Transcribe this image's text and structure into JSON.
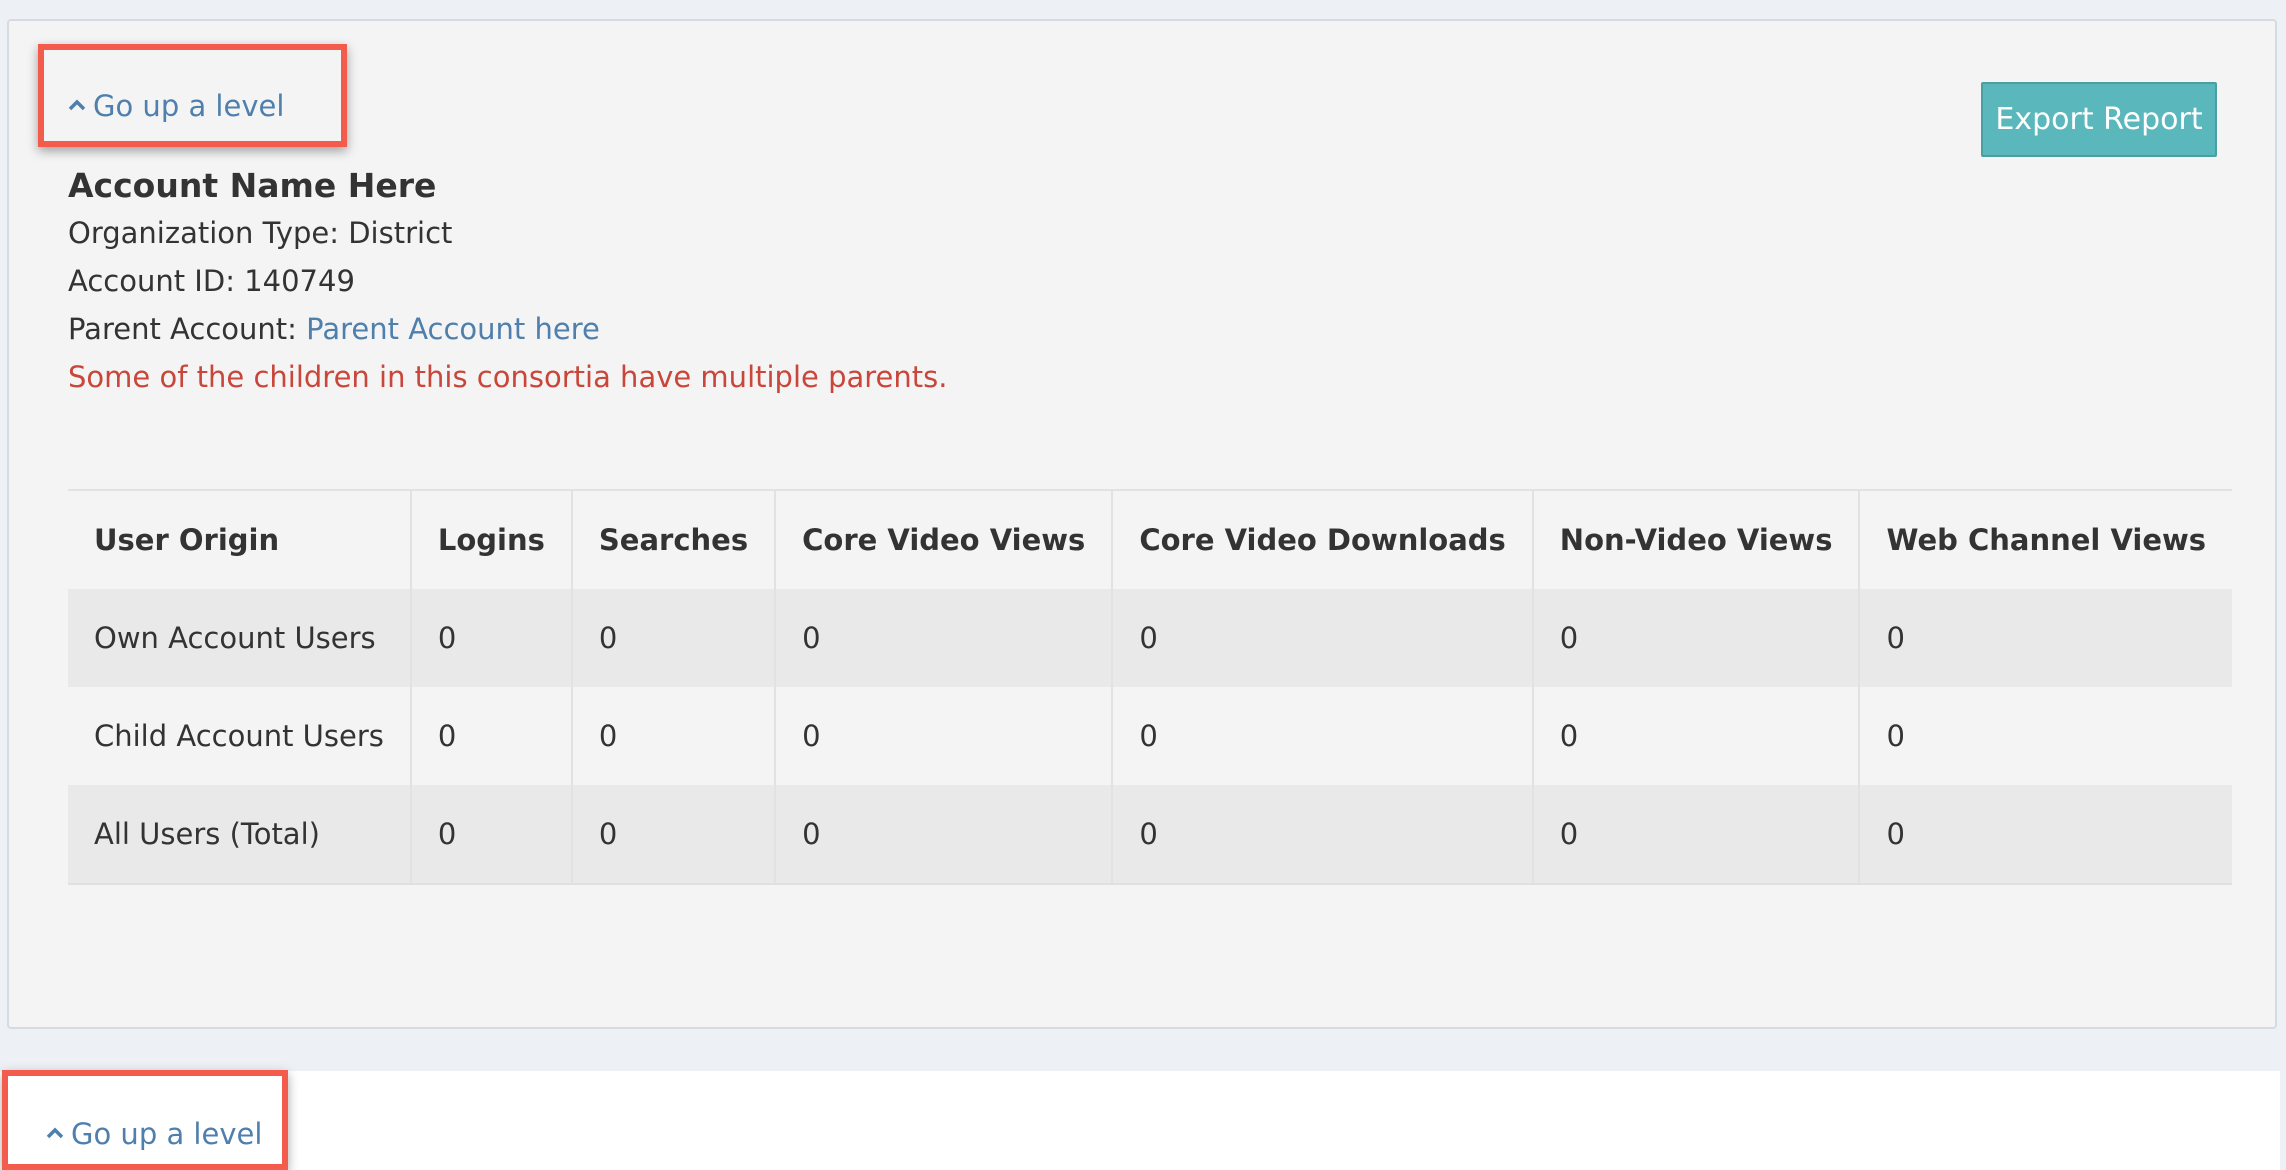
{
  "nav": {
    "go_up_label": "Go up a level",
    "go_up_label_bottom": "Go up a level"
  },
  "header": {
    "export_label": "Export Report"
  },
  "account": {
    "name": "Account Name Here",
    "org_type_label": "Organization Type: ",
    "org_type_value": "District",
    "account_id_label": "Account ID: ",
    "account_id_value": "140749",
    "parent_label": "Parent Account: ",
    "parent_link": "Parent Account here",
    "warning": "Some of the children in this consortia have multiple parents."
  },
  "table": {
    "headers": [
      "User Origin",
      "Logins",
      "Searches",
      "Core Video Views",
      "Core Video Downloads",
      "Non-Video Views",
      "Web Channel Views"
    ],
    "rows": [
      [
        "Own Account Users",
        "0",
        "0",
        "0",
        "0",
        "0",
        "0"
      ],
      [
        "Child Account Users",
        "0",
        "0",
        "0",
        "0",
        "0",
        "0"
      ],
      [
        "All Users (Total)",
        "0",
        "0",
        "0",
        "0",
        "0",
        "0"
      ]
    ]
  },
  "colors": {
    "link": "#4f7fac",
    "warning": "#c9473a",
    "export_button": "#5ab7bb",
    "highlight_box": "#f35b4c"
  },
  "icons": {
    "go_up": "chevron-up-icon"
  }
}
